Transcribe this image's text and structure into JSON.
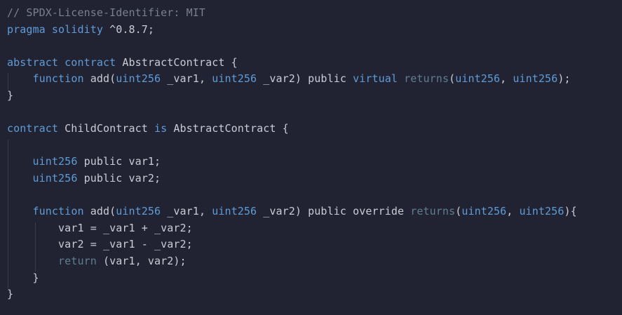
{
  "code_lines": [
    [
      {
        "text": "// SPDX-License-Identifier: MIT",
        "kind": "comment"
      }
    ],
    [
      {
        "text": "pragma solidity",
        "kind": "kw"
      },
      {
        "text": " ^0.8.7;",
        "kind": "plain"
      }
    ],
    [],
    [
      {
        "text": "abstract contract",
        "kind": "kw"
      },
      {
        "text": " AbstractContract {",
        "kind": "plain"
      }
    ],
    [
      {
        "text": "    ",
        "kind": "plain"
      },
      {
        "text": "function",
        "kind": "kw"
      },
      {
        "text": " add(",
        "kind": "plain"
      },
      {
        "text": "uint256",
        "kind": "type"
      },
      {
        "text": " _var1, ",
        "kind": "plain"
      },
      {
        "text": "uint256",
        "kind": "type"
      },
      {
        "text": " _var2) public ",
        "kind": "plain"
      },
      {
        "text": "virtual",
        "kind": "kw"
      },
      {
        "text": " ",
        "kind": "plain"
      },
      {
        "text": "returns",
        "kind": "dim"
      },
      {
        "text": "(",
        "kind": "plain"
      },
      {
        "text": "uint256",
        "kind": "type"
      },
      {
        "text": ", ",
        "kind": "plain"
      },
      {
        "text": "uint256",
        "kind": "type"
      },
      {
        "text": ");",
        "kind": "plain"
      }
    ],
    [
      {
        "text": "}",
        "kind": "plain"
      }
    ],
    [],
    [
      {
        "text": "contract",
        "kind": "kw"
      },
      {
        "text": " ChildContract ",
        "kind": "plain"
      },
      {
        "text": "is",
        "kind": "kw"
      },
      {
        "text": " AbstractContract {",
        "kind": "plain"
      }
    ],
    [],
    [
      {
        "text": "    ",
        "kind": "plain"
      },
      {
        "text": "uint256",
        "kind": "type"
      },
      {
        "text": " public var1;",
        "kind": "plain"
      }
    ],
    [
      {
        "text": "    ",
        "kind": "plain"
      },
      {
        "text": "uint256",
        "kind": "type"
      },
      {
        "text": " public var2;",
        "kind": "plain"
      }
    ],
    [],
    [
      {
        "text": "    ",
        "kind": "plain"
      },
      {
        "text": "function",
        "kind": "kw"
      },
      {
        "text": " add(",
        "kind": "plain"
      },
      {
        "text": "uint256",
        "kind": "type"
      },
      {
        "text": " _var1, ",
        "kind": "plain"
      },
      {
        "text": "uint256",
        "kind": "type"
      },
      {
        "text": " _var2) public ",
        "kind": "plain"
      },
      {
        "text": "override",
        "kind": "plain"
      },
      {
        "text": " ",
        "kind": "plain"
      },
      {
        "text": "returns",
        "kind": "dim"
      },
      {
        "text": "(",
        "kind": "plain"
      },
      {
        "text": "uint256",
        "kind": "type"
      },
      {
        "text": ", ",
        "kind": "plain"
      },
      {
        "text": "uint256",
        "kind": "type"
      },
      {
        "text": "){",
        "kind": "plain"
      }
    ],
    [
      {
        "text": "        var1 = _var1 + _var2;",
        "kind": "plain"
      }
    ],
    [
      {
        "text": "        var2 = _var1 - _var2;",
        "kind": "plain"
      }
    ],
    [
      {
        "text": "        ",
        "kind": "plain"
      },
      {
        "text": "return",
        "kind": "dim"
      },
      {
        "text": " (var1, var2);",
        "kind": "plain"
      }
    ],
    [
      {
        "text": "    }",
        "kind": "plain"
      }
    ],
    [
      {
        "text": "}",
        "kind": "plain"
      }
    ]
  ],
  "colors": {
    "background": "#222332",
    "keyword": "#5e9cd8",
    "text": "#c9ccd6",
    "comment": "#7a7f8e",
    "muted_keyword": "#5f7f8a",
    "indent_guide": "#3a3c4e"
  }
}
